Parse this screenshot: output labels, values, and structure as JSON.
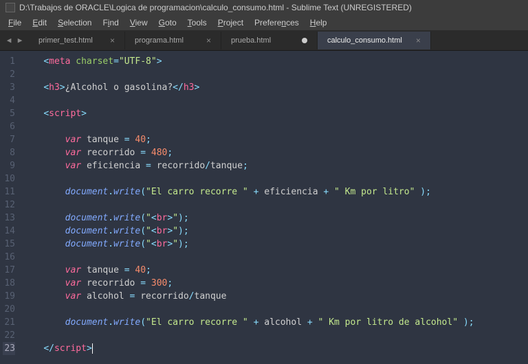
{
  "window": {
    "title": "D:\\Trabajos de ORACLE\\Logica de programacion\\calculo_consumo.html - Sublime Text (UNREGISTERED)"
  },
  "menu": {
    "file": "File",
    "edit": "Edit",
    "selection": "Selection",
    "find": "Find",
    "view": "View",
    "goto": "Goto",
    "tools": "Tools",
    "project": "Project",
    "preferences": "Preferences",
    "help": "Help"
  },
  "tabs": [
    {
      "label": "primer_test.html",
      "dirty": false,
      "active": false
    },
    {
      "label": "programa.html",
      "dirty": false,
      "active": false
    },
    {
      "label": "prueba.html",
      "dirty": true,
      "active": false
    },
    {
      "label": "calculo_consumo.html",
      "dirty": false,
      "active": true
    }
  ],
  "editor": {
    "active_line": 23,
    "lines": [
      1,
      2,
      3,
      4,
      5,
      6,
      7,
      8,
      9,
      10,
      11,
      12,
      13,
      14,
      15,
      16,
      17,
      18,
      19,
      20,
      21,
      22,
      23
    ],
    "code": {
      "meta_tag": "meta",
      "charset_attr": "charset",
      "charset_val": "\"UTF-8\"",
      "h3_tag": "h3",
      "h3_text": "¿Alcohol o gasolina?",
      "script_tag": "script",
      "var_kw": "var",
      "tanque_id": "tanque",
      "tanque_val": "40",
      "recorrido_id": "recorrido",
      "recorrido_val": "480",
      "eficiencia_id": "eficiencia",
      "document_obj": "document",
      "write_fn": "write",
      "str_recorre": "\"El carro recorre \"",
      "str_km_litro": "\" Km por litro\"",
      "str_br": "\"<br>\"",
      "recorrido2_val": "300",
      "alcohol_id": "alcohol",
      "plus": "+",
      "slash": "/",
      "semi": ";",
      "eq": "=",
      "str_km_litro_alcohol": "\" Km por litro de alcohol\""
    }
  }
}
